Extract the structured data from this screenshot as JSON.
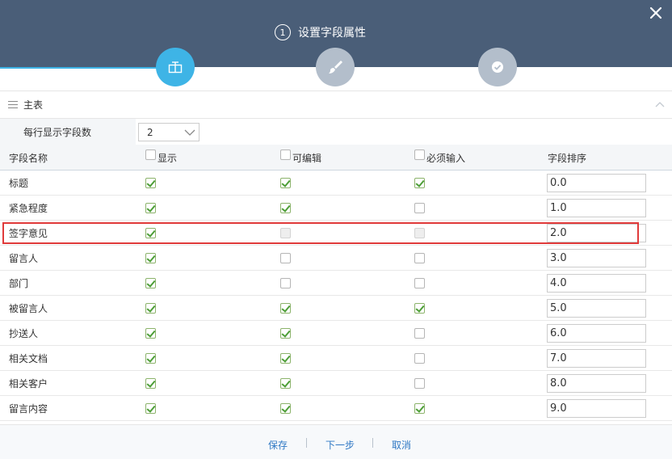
{
  "header": {
    "step_number": "1",
    "step_title": "设置字段属性",
    "close_icon": "close-icon",
    "steps": [
      {
        "icon": "field-layout-icon",
        "state": "active"
      },
      {
        "icon": "brush-icon",
        "state": "inactive"
      },
      {
        "icon": "check-circle-icon",
        "state": "inactive"
      }
    ],
    "accent_color": "#3eb4e6",
    "header_color": "#4a5e78"
  },
  "section": {
    "title": "主表",
    "collapse_icon": "chevron-up-icon"
  },
  "per_row": {
    "label": "每行显示字段数",
    "value": "2"
  },
  "table": {
    "columns": {
      "name": "字段名称",
      "show": "显示",
      "edit": "可编辑",
      "required": "必须输入",
      "order": "字段排序"
    },
    "rows": [
      {
        "name": "标题",
        "show": "checked",
        "edit": "checked",
        "required": "checked",
        "order": "0.0"
      },
      {
        "name": "紧急程度",
        "show": "checked",
        "edit": "checked",
        "required": "unchecked",
        "order": "1.0"
      },
      {
        "name": "签字意见",
        "show": "checked",
        "edit": "disabled",
        "required": "disabled",
        "order": "2.0"
      },
      {
        "name": "留言人",
        "show": "checked",
        "edit": "unchecked",
        "required": "unchecked",
        "order": "3.0"
      },
      {
        "name": "部门",
        "show": "checked",
        "edit": "unchecked",
        "required": "unchecked",
        "order": "4.0"
      },
      {
        "name": "被留言人",
        "show": "checked",
        "edit": "checked",
        "required": "checked",
        "order": "5.0"
      },
      {
        "name": "抄送人",
        "show": "checked",
        "edit": "checked",
        "required": "unchecked",
        "order": "6.0"
      },
      {
        "name": "相关文档",
        "show": "checked",
        "edit": "checked",
        "required": "unchecked",
        "order": "7.0"
      },
      {
        "name": "相关客户",
        "show": "checked",
        "edit": "checked",
        "required": "unchecked",
        "order": "8.0"
      },
      {
        "name": "留言内容",
        "show": "checked",
        "edit": "checked",
        "required": "checked",
        "order": "9.0"
      }
    ]
  },
  "footer": {
    "save_label": "保存",
    "next_label": "下一步",
    "cancel_label": "取消"
  }
}
